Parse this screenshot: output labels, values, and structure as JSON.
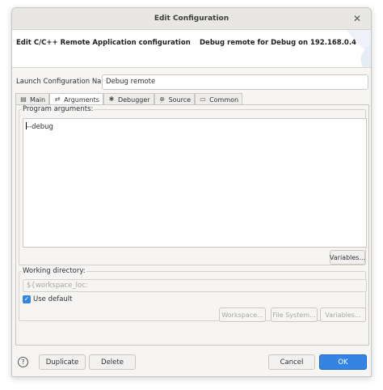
{
  "window": {
    "title": "Edit Configuration"
  },
  "banner": {
    "left_title": "Edit C/C++ Remote Application configuration",
    "right_title": "Debug remote for Debug on 192.168.0.4"
  },
  "launch_name": {
    "label": "Launch Configuration Name:",
    "value": "Debug remote"
  },
  "tabs": [
    {
      "label": "Main",
      "icon": "main-tab-icon"
    },
    {
      "label": "Arguments",
      "icon": "arguments-tab-icon",
      "active": true
    },
    {
      "label": "Debugger",
      "icon": "debugger-tab-icon"
    },
    {
      "label": "Source",
      "icon": "source-tab-icon"
    },
    {
      "label": "Common",
      "icon": "common-tab-icon"
    }
  ],
  "program_arguments": {
    "label": "Program arguments:",
    "value": "--debug",
    "variables_button": "Variables..."
  },
  "working_directory": {
    "label": "Working directory:",
    "value": "${workspace_loc:",
    "use_default_label": "Use default",
    "use_default_checked": true,
    "workspace_button": "Workspace...",
    "file_system_button": "File System...",
    "variables_button": "Variables..."
  },
  "footer": {
    "help_icon": "?",
    "duplicate": "Duplicate",
    "delete": "Delete",
    "cancel": "Cancel",
    "ok": "OK"
  },
  "colors": {
    "accent": "#3584e4"
  }
}
